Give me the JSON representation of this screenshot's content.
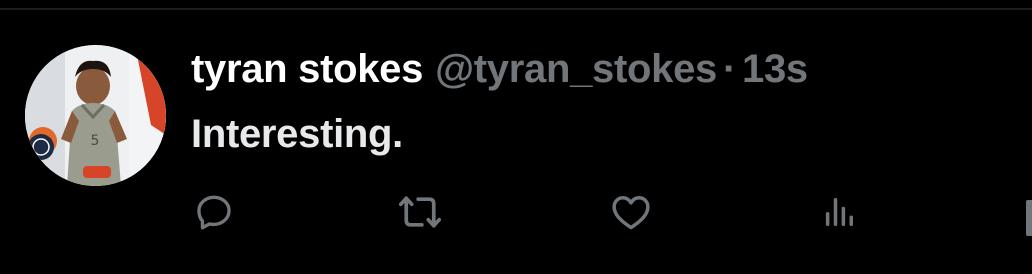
{
  "tweet": {
    "display_name": "tyran stokes",
    "handle": "@tyran_stokes",
    "separator": "·",
    "timestamp": "13s",
    "text": "Interesting."
  },
  "actions": {
    "reply_icon": "reply-icon",
    "retweet_icon": "retweet-icon",
    "like_icon": "heart-icon",
    "views_icon": "analytics-icon"
  },
  "colors": {
    "background": "#000000",
    "primary_text": "#ffffff",
    "secondary_text": "#71767b"
  }
}
